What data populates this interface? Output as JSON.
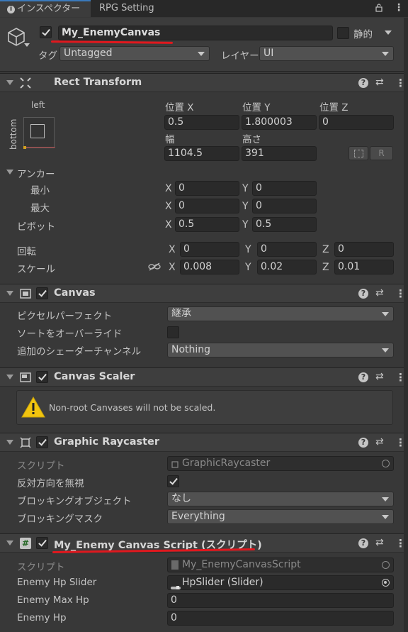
{
  "tabs": {
    "inspector": "インスペクター",
    "rpg": "RPG Setting"
  },
  "object": {
    "name": "My_EnemyCanvas",
    "static_label": "静的",
    "tag_label": "タグ",
    "tag_value": "Untagged",
    "layer_label": "レイヤー",
    "layer_value": "UI"
  },
  "rect": {
    "title": "Rect Transform",
    "anchor_h": "left",
    "anchor_v": "bottom",
    "posx_label": "位置 X",
    "posy_label": "位置 Y",
    "posz_label": "位置 Z",
    "posx": "0.5",
    "posy": "1.800003",
    "posz": "0",
    "width_label": "幅",
    "height_label": "高さ",
    "width": "1104.5",
    "height": "391",
    "r_btn": "R",
    "anchors_label": "アンカー",
    "min_label": "最小",
    "max_label": "最大",
    "pivot_label": "ピボット",
    "min_x": "0",
    "min_y": "0",
    "max_x": "0",
    "max_y": "0",
    "pivot_x": "0.5",
    "pivot_y": "0.5",
    "rot_label": "回転",
    "scale_label": "スケール",
    "rot_x": "0",
    "rot_y": "0",
    "rot_z": "0",
    "scale_x": "0.008",
    "scale_y": "0.02",
    "scale_z": "0.01",
    "x": "X",
    "y": "Y",
    "z": "Z"
  },
  "canvas": {
    "title": "Canvas",
    "pixel_perfect_label": "ピクセルパーフェクト",
    "pixel_perfect_value": "継承",
    "override_sort_label": "ソートをオーバーライド",
    "shader_channels_label": "追加のシェーダーチャンネル",
    "shader_channels_value": "Nothing"
  },
  "scaler": {
    "title": "Canvas Scaler",
    "warning": "Non-root Canvases will not be scaled."
  },
  "raycaster": {
    "title": "Graphic Raycaster",
    "script_label": "スクリプト",
    "script_value": "GraphicRaycaster",
    "ignore_reversed_label": "反対方向を無視",
    "blocking_objects_label": "ブロッキングオブジェクト",
    "blocking_objects_value": "なし",
    "blocking_mask_label": "ブロッキングマスク",
    "blocking_mask_value": "Everything"
  },
  "script": {
    "title": "My_Enemy Canvas Script (スクリプト)",
    "script_label": "スクリプト",
    "script_value": "My_EnemyCanvasScript",
    "slider_label": "Enemy Hp Slider",
    "slider_value": "HpSlider (Slider)",
    "max_hp_label": "Enemy Max Hp",
    "max_hp_value": "0",
    "hp_label": "Enemy Hp",
    "hp_value": "0"
  },
  "colors": {
    "accent": "#3a79bb",
    "annotation": "#e0181e"
  }
}
